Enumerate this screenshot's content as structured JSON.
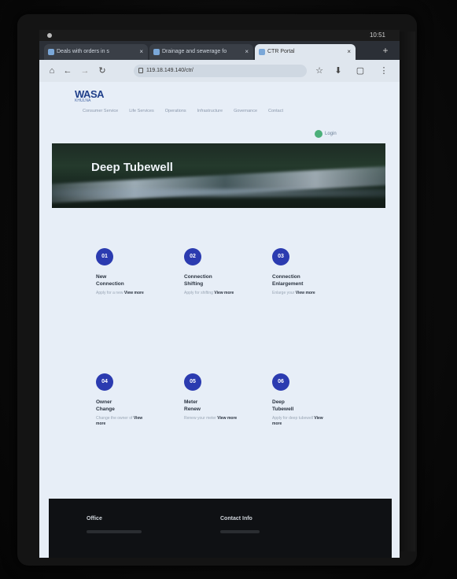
{
  "status_bar": {
    "time": "10:51"
  },
  "tabs": [
    {
      "label": "Deals with orders in s"
    },
    {
      "label": "Drainage and sewerage fo"
    },
    {
      "label": "CTR Portal"
    }
  ],
  "address_bar": {
    "url": "119.18.149.140/ctr/"
  },
  "site": {
    "logo_text": "WASA",
    "logo_sub": "KHULNA",
    "nav": [
      "Consumer Service",
      "Life Services",
      "Operations",
      "Infrastructure",
      "Governance",
      "Contact"
    ],
    "login_label": "Login"
  },
  "hero": {
    "title": "Deep Tubewell"
  },
  "services": [
    {
      "num": "01",
      "title": "New\nConnection",
      "desc": "Apply for a new",
      "more": "View more"
    },
    {
      "num": "02",
      "title": "Connection\nShifting",
      "desc": "Apply for shifting",
      "more": "View more"
    },
    {
      "num": "03",
      "title": "Connection\nEnlargement",
      "desc": "Enlarge your",
      "more": "View more"
    },
    {
      "num": "04",
      "title": "Owner\nChange",
      "desc": "Change the owner of",
      "more": "View more"
    },
    {
      "num": "05",
      "title": "Meter\nRenew",
      "desc": "Renew your meter",
      "more": "View more"
    },
    {
      "num": "06",
      "title": "Deep\nTubewell",
      "desc": "Apply for deep tubewell",
      "more": "View more"
    }
  ],
  "footer": {
    "office_label": "Office",
    "contact_label": "Contact Info"
  },
  "colors": {
    "accent": "#2b3bb0",
    "page_bg": "#e7eef7",
    "footer_bg": "#0f1114"
  }
}
